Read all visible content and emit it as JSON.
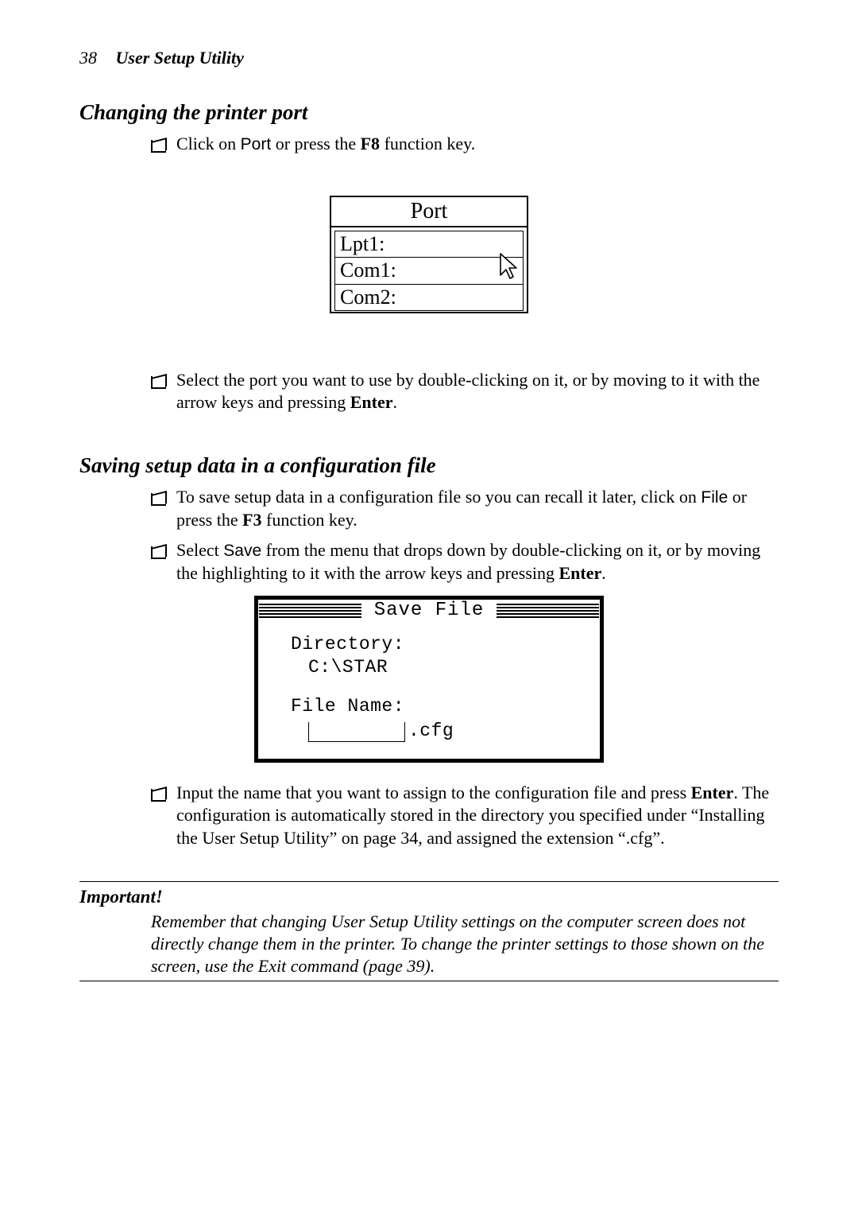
{
  "page": {
    "number": "38",
    "chapter_title": "User Setup Utility"
  },
  "section1": {
    "heading": "Changing the printer port",
    "step1": {
      "pre": "Click on ",
      "port_word": "Port",
      "mid": " or press the ",
      "f8": "F8",
      "post": " function key."
    },
    "port_dialog": {
      "title": "Port",
      "items": [
        "Lpt1:",
        "Com1:",
        "Com2:"
      ]
    },
    "step2": {
      "pre": "Select the port you want to use by double-clicking on it, or by moving to it with the arrow keys and pressing ",
      "enter": "Enter",
      "post": "."
    }
  },
  "section2": {
    "heading": "Saving setup data in a configuration file",
    "step1": {
      "pre": "To save setup data in a configuration file so you can recall it later, click on ",
      "file_word": "File",
      "mid": " or press the ",
      "f3": "F3",
      "post": " function key."
    },
    "step2": {
      "pre": "Select ",
      "save_word": "Save",
      "mid": " from the menu that drops down by double-clicking on it, or by moving the highlighting to it with the arrow keys and pressing ",
      "enter": "Enter",
      "post": "."
    },
    "save_dialog": {
      "title": "Save File",
      "dir_label": "Directory:",
      "dir_value": "C:\\STAR",
      "file_label": "File Name:",
      "file_value": "",
      "file_ext": ".cfg"
    },
    "step3": {
      "pre": "Input the name that you want to assign to the configuration file and press ",
      "enter": "Enter",
      "post": ". The configuration is automatically stored in the directory you specified under “Installing the User Setup Utility” on page 34, and assigned the extension “.cfg”."
    }
  },
  "important": {
    "label": "Important!",
    "body": "Remember that changing User Setup Utility settings on the computer screen does not directly change them in the printer. To change the printer settings to those shown on the screen, use the Exit command (page 39)."
  }
}
